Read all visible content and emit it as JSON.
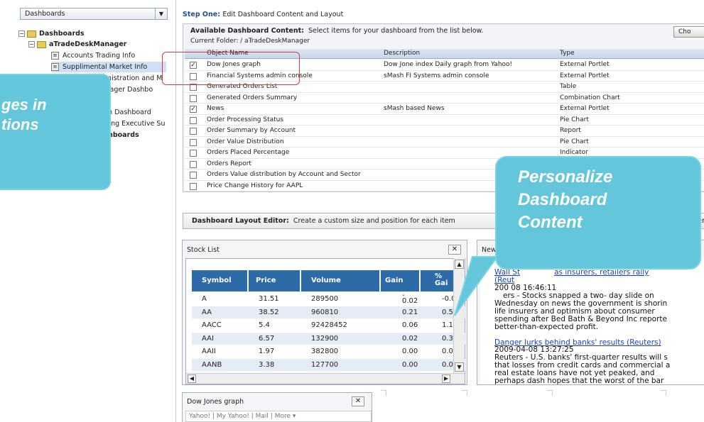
{
  "left": {
    "dropdown": "Dashboards",
    "tree": [
      {
        "label": "Dashboards",
        "bold": true
      },
      {
        "label": "aTradeDeskManager",
        "bold": true
      },
      {
        "label": "Accounts Trading Info"
      },
      {
        "label": "Supplimental Market Info"
      },
      {
        "label": "stem Administration and M"
      },
      {
        "label": "k Manager Dashbo"
      },
      {
        "label": "ox",
        "bold": true
      },
      {
        "label": "tion Dashboard"
      },
      {
        "label": "toring Executive Su"
      },
      {
        "label": "ashboards",
        "bold": true
      }
    ]
  },
  "callouts": {
    "left_lines": [
      "ges in",
      "tions"
    ],
    "right_lines": [
      "Personalize",
      "Dashboard",
      "Content"
    ]
  },
  "main": {
    "step_one_label": "Step One:",
    "step_one_text": "Edit Dashboard Content and Layout",
    "content_title": "Available Dashboard Content:",
    "content_hint": "Select items for your dashboard from the list below.",
    "current_folder": "Current Folder: / aTradeDeskManager",
    "choose_btn": "Cho",
    "columns": [
      "Object Name",
      "Description",
      "Type"
    ],
    "rows": [
      {
        "checked": true,
        "name": "Dow Jones graph",
        "desc": "Dow Jone index Daily graph from Yahoo!",
        "type": "External Portlet"
      },
      {
        "checked": false,
        "name": "Financial Systems admin console",
        "desc": "sMash FI Systems admin console",
        "type": "External Portlet"
      },
      {
        "checked": false,
        "name": "Generated Orders List",
        "desc": "",
        "type": "Table"
      },
      {
        "checked": false,
        "name": "Generated Orders Summary",
        "desc": "",
        "type": "Combination Chart"
      },
      {
        "checked": true,
        "name": "News",
        "desc": "sMash based News",
        "type": "External Portlet"
      },
      {
        "checked": false,
        "name": "Order Processing Status",
        "desc": "",
        "type": "Pie Chart"
      },
      {
        "checked": false,
        "name": "Order Summary by Account",
        "desc": "",
        "type": "Report"
      },
      {
        "checked": false,
        "name": "Order Value Distribution",
        "desc": "",
        "type": "Pie Chart"
      },
      {
        "checked": false,
        "name": "Orders Placed Percentage",
        "desc": "",
        "type": "Indicator"
      },
      {
        "checked": false,
        "name": "Orders Report",
        "desc": "",
        "type": ""
      },
      {
        "checked": false,
        "name": "Orders Value distribution by Account and Sector",
        "desc": "",
        "type": ""
      },
      {
        "checked": false,
        "name": "Price Change History for AAPL",
        "desc": "",
        "type": ""
      }
    ],
    "layout_title": "Dashboard Layout Editor:",
    "layout_hint": "Create a custom size and position for each item",
    "layout_trail": "er"
  },
  "stock": {
    "title": "Stock List",
    "headers": [
      "Symbol",
      "Price",
      "Volume",
      "Gain",
      "%",
      "Gai"
    ],
    "rows": [
      [
        "A",
        "31.51",
        "289500",
        "-",
        "0.02",
        "-0.0"
      ],
      [
        "AA",
        "38.52",
        "960810",
        "",
        "0.21",
        "0.55"
      ],
      [
        "AACC",
        "5.4",
        "92428452",
        "",
        "0.06",
        "1.12"
      ],
      [
        "AAI",
        "6.57",
        "132900",
        "",
        "0.02",
        "0.31"
      ],
      [
        "AAII",
        "1.97",
        "382800",
        "",
        "0.00",
        "0.00"
      ],
      [
        "AANB",
        "3.38",
        "127700",
        "",
        "0.00",
        "0.00"
      ]
    ]
  },
  "news": {
    "title": "New",
    "link1a": "Wall St",
    "link1b": "as insurers, retailers rally",
    "link1c": "(Reut",
    "date1": "200     08 16:46:11",
    "body1": [
      "ers - Stocks snapped a two- day slide on",
      "Wednesday on news the government is shorin",
      "life insurers and optimism about consumer",
      "spending after Bed Bath & Beyond Inc reporte",
      "better-than-expected profit."
    ],
    "link2": "Danger lurks behind banks' results (Reuters)",
    "date2": "2009-04-08 13:27:25",
    "body2": [
      "Reuters - U.S. banks' first-quarter results will s",
      "that losses from credit cards and commercial a",
      "real estate loans have not yet peaked, and",
      "perhaps dash hopes that the worst of the bar"
    ]
  },
  "dj": {
    "title": "Dow Jones graph",
    "yahoo": "Yahoo!  |  My Yahoo!  |  Mail  |  More ▾"
  }
}
